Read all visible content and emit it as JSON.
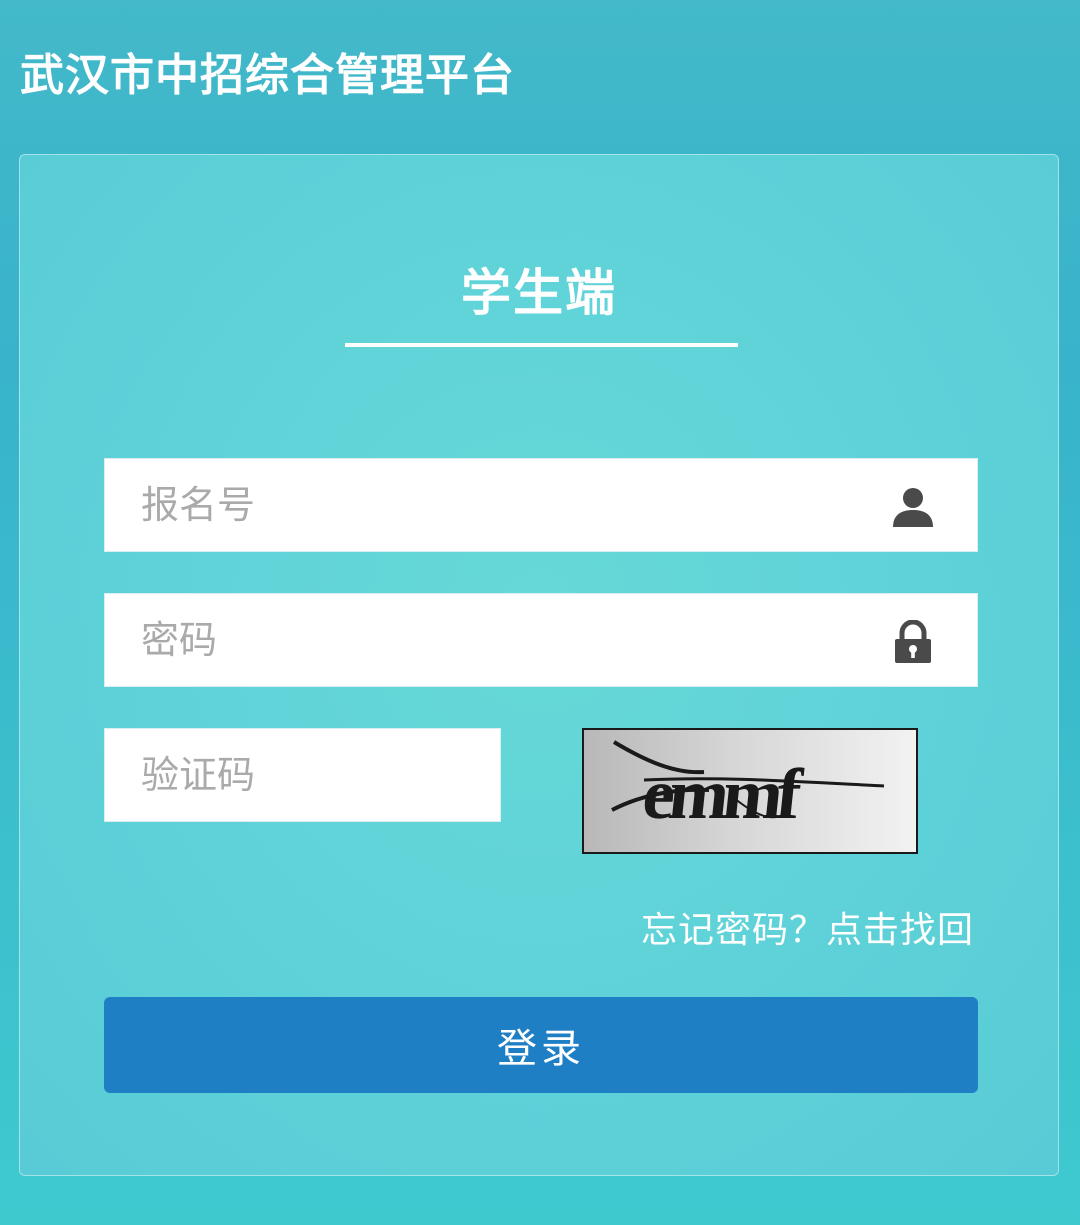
{
  "header": {
    "app_title": "武汉市中招综合管理平台"
  },
  "login": {
    "title": "学生端",
    "username_placeholder": "报名号",
    "username_value": "",
    "password_placeholder": "密码",
    "password_value": "",
    "captcha_placeholder": "验证码",
    "captcha_value": "",
    "captcha_image_text": "emmf",
    "forgot_link": "忘记密码？点击找回",
    "login_button": "登录"
  },
  "icons": {
    "username": "user-icon",
    "password": "lock-icon"
  },
  "colors": {
    "primary_button": "#1f7fc4",
    "background": "#3cbccd",
    "text_on_accent": "#ffffff"
  }
}
